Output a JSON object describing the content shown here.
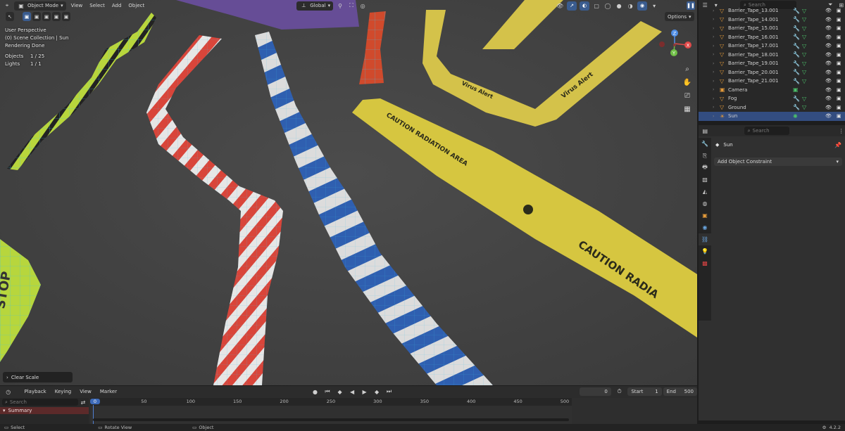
{
  "viewport_header": {
    "mode": "Object Mode",
    "menus": [
      "View",
      "Select",
      "Add",
      "Object"
    ],
    "orientation": "Global",
    "options_label": "Options"
  },
  "viewport_info": {
    "view_name": "User Perspective",
    "collection": "(0) Scene Collection | Sun",
    "render_status": "Rendering Done",
    "objects_label": "Objects",
    "objects_value": "1 / 25",
    "lights_label": "Lights",
    "lights_value": "1 / 1"
  },
  "scene_labels": {
    "radiation_1": "CAUTION RADIATION AREA",
    "radiation_2": "CAUTION RADIA",
    "virus_1": "Virus Alert",
    "virus_2": "Virus Alert",
    "stop": "STOP"
  },
  "gizmo": {
    "x": "X",
    "y": "Y",
    "z": "Z"
  },
  "last_operator": "Clear Scale",
  "outliner": {
    "search_placeholder": "Search",
    "items": [
      {
        "name": "Barrier_Tape_13.001",
        "type": "mesh",
        "selected": false
      },
      {
        "name": "Barrier_Tape_14.001",
        "type": "mesh",
        "selected": false
      },
      {
        "name": "Barrier_Tape_15.001",
        "type": "mesh",
        "selected": false
      },
      {
        "name": "Barrier_Tape_16.001",
        "type": "mesh",
        "selected": false
      },
      {
        "name": "Barrier_Tape_17.001",
        "type": "mesh",
        "selected": false
      },
      {
        "name": "Barrier_Tape_18.001",
        "type": "mesh",
        "selected": false
      },
      {
        "name": "Barrier_Tape_19.001",
        "type": "mesh",
        "selected": false
      },
      {
        "name": "Barrier_Tape_20.001",
        "type": "mesh",
        "selected": false
      },
      {
        "name": "Barrier_Tape_21.001",
        "type": "mesh",
        "selected": false
      },
      {
        "name": "Camera",
        "type": "camera",
        "selected": false
      },
      {
        "name": "Fog",
        "type": "mesh",
        "selected": false
      },
      {
        "name": "Ground",
        "type": "mesh",
        "selected": false
      },
      {
        "name": "Sun",
        "type": "light",
        "selected": true
      }
    ]
  },
  "properties": {
    "search_placeholder": "Search",
    "object_name": "Sun",
    "add_constraint_label": "Add Object Constraint"
  },
  "timeline": {
    "menus": [
      "Playback",
      "Keying",
      "View",
      "Marker"
    ],
    "current_frame": "0",
    "start_label": "Start",
    "start_value": "1",
    "end_label": "End",
    "end_value": "500",
    "search_placeholder": "Search",
    "summary_label": "Summary",
    "ruler": [
      "0",
      "50",
      "100",
      "150",
      "200",
      "250",
      "300",
      "350",
      "400",
      "450",
      "500"
    ]
  },
  "statusbar": {
    "select": "Select",
    "rotate": "Rotate View",
    "object": "Object",
    "version": "4.2.2"
  },
  "colors": {
    "accent": "#3d6ab8",
    "selection": "#334d80",
    "tape_red": "#d9453a",
    "tape_blue": "#2f5fb0",
    "tape_yellow": "#d6c640",
    "tape_green": "#a8c83a",
    "mesh_wire": "#3fc1e6"
  }
}
